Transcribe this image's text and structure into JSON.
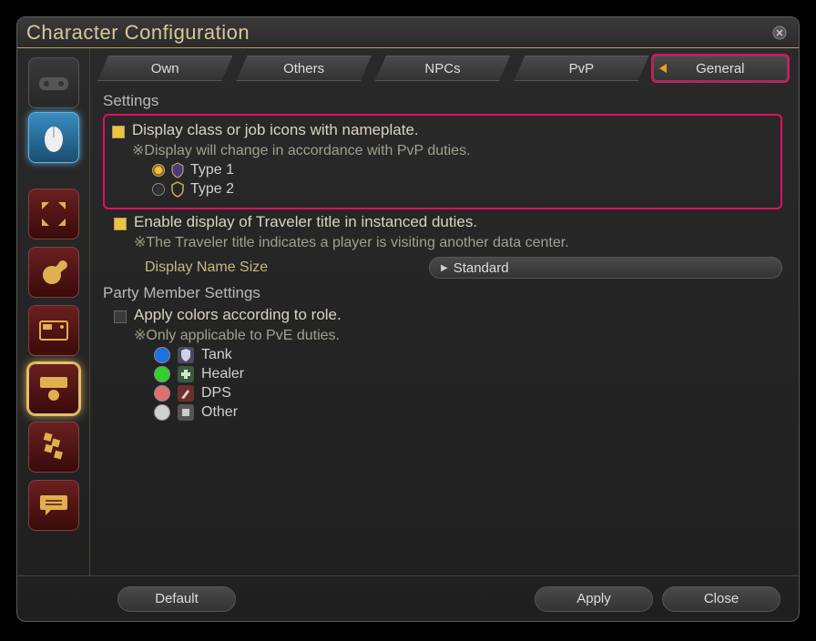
{
  "window": {
    "title": "Character Configuration"
  },
  "tabs": {
    "own": "Own",
    "others": "Others",
    "npcs": "NPCs",
    "pvp": "PvP",
    "general": "General",
    "active": "general"
  },
  "sections": {
    "settings_title": "Settings",
    "party_title": "Party Member Settings"
  },
  "nameplate_icons": {
    "label": "Display class or job icons with nameplate.",
    "note": "※Display will change in accordance with PvP duties.",
    "type1": "Type 1",
    "type2": "Type 2"
  },
  "traveler": {
    "label": "Enable display of Traveler title in instanced duties.",
    "note": "※The Traveler title indicates a player is visiting another data center."
  },
  "display_name_size": {
    "label": "Display Name Size",
    "value": "Standard"
  },
  "role_colors": {
    "label": "Apply colors according to role.",
    "note": "※Only applicable to PvE duties.",
    "tank": "Tank",
    "healer": "Healer",
    "dps": "DPS",
    "other": "Other",
    "colors": {
      "tank": "#2070e0",
      "healer": "#30d030",
      "dps": "#e07070",
      "other": "#d0d0d0"
    }
  },
  "buttons": {
    "default": "Default",
    "apply": "Apply",
    "close": "Close"
  }
}
